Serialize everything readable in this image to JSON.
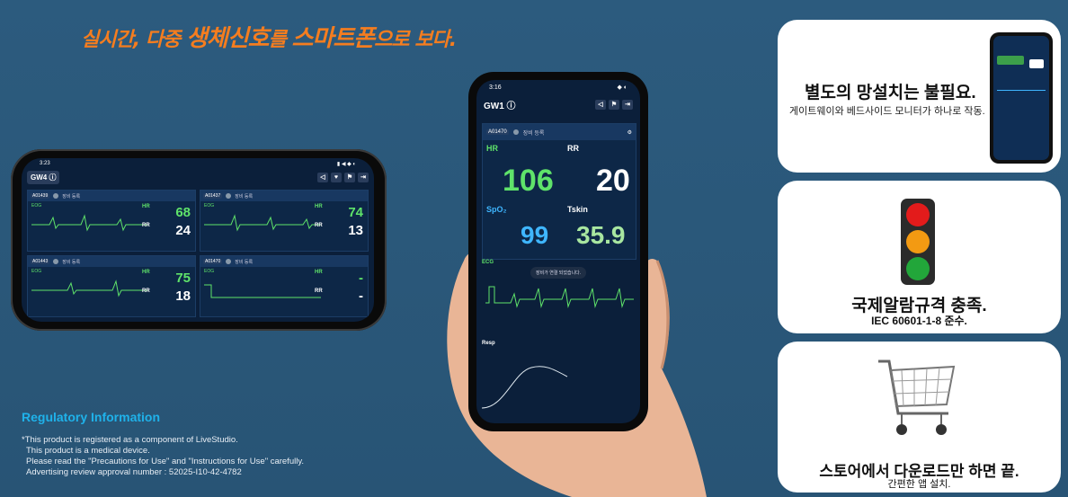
{
  "headline": {
    "part1": "실시간, 다중 ",
    "part2": "생체신호",
    "part3": "를 ",
    "part4": "스마트폰",
    "part5": "으로 보다."
  },
  "landscape_phone": {
    "time": "3:23",
    "gateway": "GW4",
    "monitors": [
      {
        "id": "A01439",
        "register": "장비 등록",
        "wave_label": "EOG",
        "hr_label": "HR",
        "rr_label": "RR",
        "hr": "68",
        "rr": "24"
      },
      {
        "id": "A01437",
        "register": "장비 등록",
        "wave_label": "EOG",
        "hr_label": "HR",
        "rr_label": "RR",
        "hr": "74",
        "rr": "13"
      },
      {
        "id": "A01443",
        "register": "장비 등록",
        "wave_label": "EOG",
        "hr_label": "HR",
        "rr_label": "RR",
        "hr": "75",
        "rr": "18"
      },
      {
        "id": "A01470",
        "register": "장비 등록",
        "wave_label": "EOG",
        "hr_label": "HR",
        "rr_label": "RR",
        "hr": "-",
        "rr": "-"
      }
    ]
  },
  "portrait_phone": {
    "time": "3:16",
    "gateway": "GW1",
    "device_id": "A01470",
    "register": "장비 등록",
    "hr_label": "HR",
    "rr_label": "RR",
    "spo2_label": "SpO₂",
    "tskin_label": "Tskin",
    "hr": "106",
    "rr": "20",
    "spo2": "99",
    "tskin": "35.9",
    "ecg_label": "ECG",
    "notice": "장비가 연결 되었습니다.",
    "resp_label": "Resp"
  },
  "cards": {
    "network": {
      "title": "별도의 망설치는 불필요.",
      "subtitle": "게이트웨이와 베드사이드 모니터가 하나로 작동."
    },
    "alarm": {
      "title": "국제알람규격 충족.",
      "subtitle": "IEC 60601-1-8 준수."
    },
    "store": {
      "title": "스토어에서 다운로드만 하면 끝.",
      "subtitle": "간편한 앱 설치."
    }
  },
  "regulatory": {
    "title": "Regulatory Information",
    "lines": [
      "*This product is registered as a component of LiveStudio.",
      "This product is a medical device.",
      "Please read the \"Precautions for Use\" and  \"Instructions for Use\" carefully.",
      "Advertising review approval number : 52025-I10-42-4782"
    ]
  },
  "colors": {
    "background": "#2a5779",
    "accent_orange": "#f57d1f",
    "hr_green": "#5fe36a",
    "spo2_blue": "#3fb6ff",
    "tskin_lightgreen": "#a8e6a0",
    "reg_blue": "#1fb2ea"
  }
}
